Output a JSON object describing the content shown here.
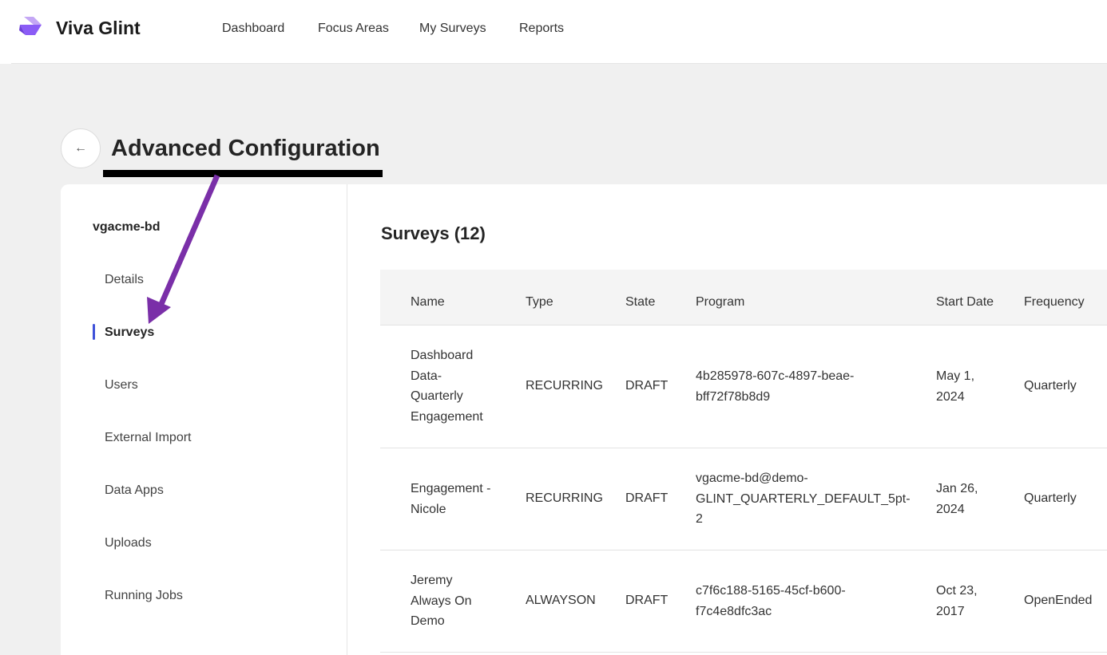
{
  "app": {
    "brand": "Viva Glint",
    "nav": [
      {
        "label": "Dashboard"
      },
      {
        "label": "Focus Areas"
      },
      {
        "label": "My Surveys"
      },
      {
        "label": "Reports"
      }
    ]
  },
  "page": {
    "title": "Advanced Configuration",
    "back_icon": "←"
  },
  "sidebar": {
    "org": "vgacme-bd",
    "items": [
      {
        "label": "Details",
        "active": false
      },
      {
        "label": "Surveys",
        "active": true
      },
      {
        "label": "Users",
        "active": false
      },
      {
        "label": "External Import",
        "active": false
      },
      {
        "label": "Data Apps",
        "active": false
      },
      {
        "label": "Uploads",
        "active": false
      },
      {
        "label": "Running Jobs",
        "active": false
      }
    ]
  },
  "surveys": {
    "heading": "Surveys (12)",
    "columns": [
      "Name",
      "Type",
      "State",
      "Program",
      "Start Date",
      "Frequency"
    ],
    "rows": [
      {
        "name": "Dashboard\nData-\nQuarterly\nEngagement",
        "type": "RECURRING",
        "state": "DRAFT",
        "program": "4b285978-607c-4897-beae-\nbff72f78b8d9",
        "start_date": "May 1,\n2024",
        "frequency": "Quarterly"
      },
      {
        "name": "Engagement -\nNicole",
        "type": "RECURRING",
        "state": "DRAFT",
        "program": "vgacme-bd@demo-\nGLINT_QUARTERLY_DEFAULT_5pt-\n2",
        "start_date": "Jan 26,\n2024",
        "frequency": "Quarterly"
      },
      {
        "name": "Jeremy\nAlways On\nDemo",
        "type": "ALWAYSON",
        "state": "DRAFT",
        "program": "c7f6c188-5165-45cf-b600-\nf7c4e8dfc3ac",
        "start_date": "Oct 23,\n2017",
        "frequency": "OpenEnded"
      }
    ]
  },
  "colors": {
    "accent": "#3f51d9",
    "annotation_arrow": "#7a2fa8",
    "logo_primary": "#8b5cf6",
    "logo_secondary": "#c4a7f5"
  }
}
